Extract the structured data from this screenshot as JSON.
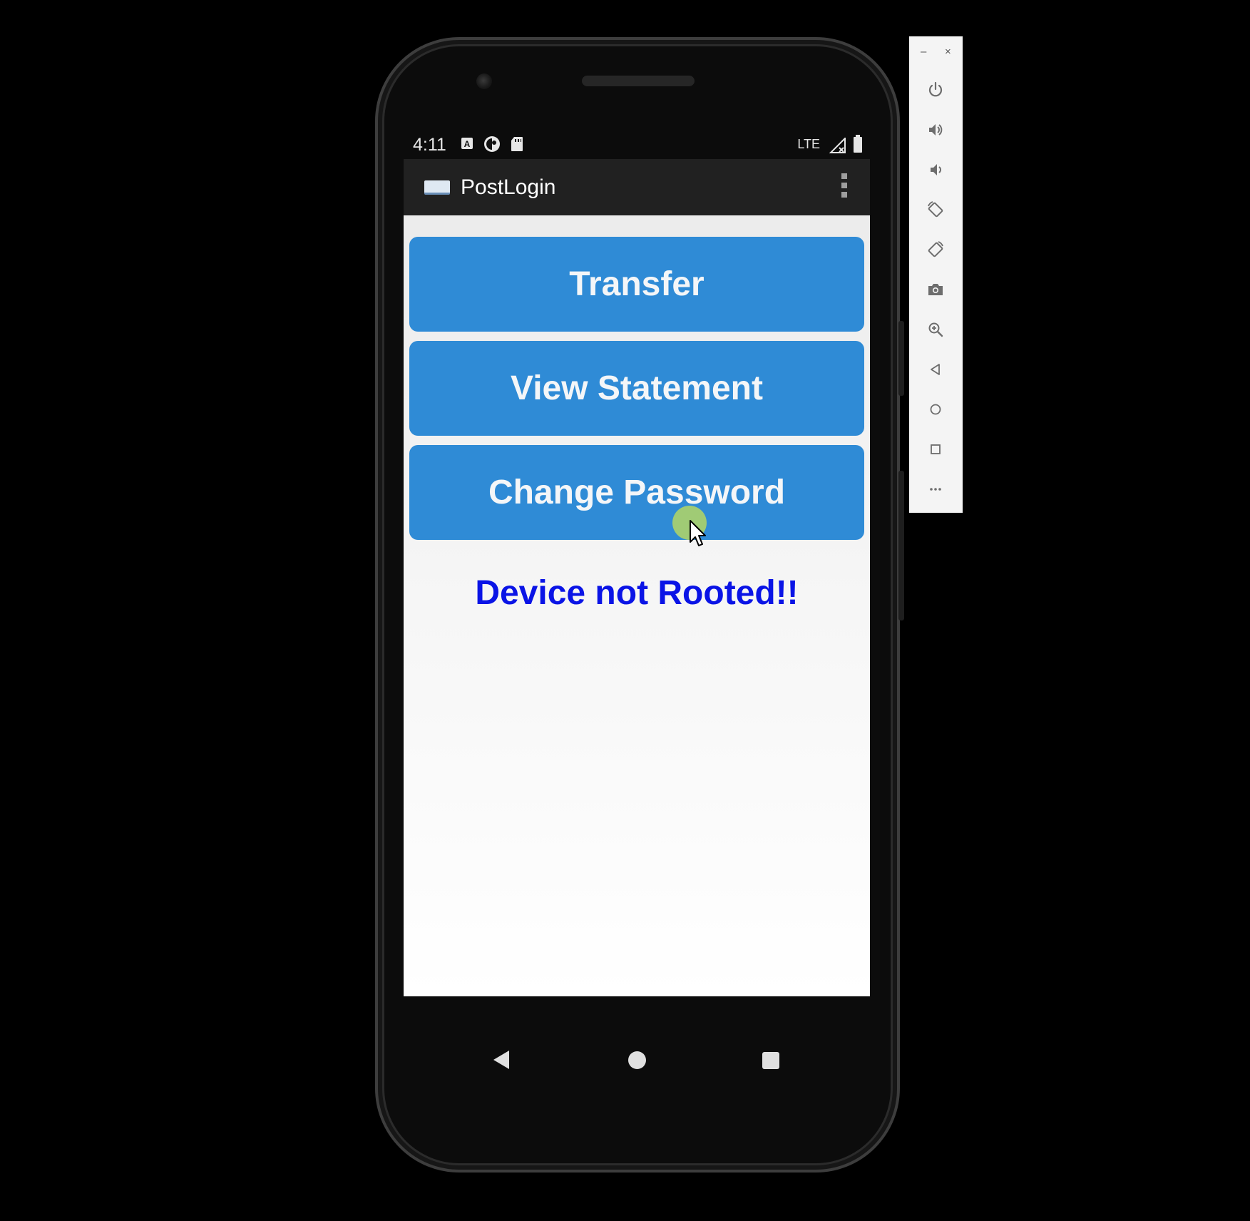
{
  "status_bar": {
    "time": "4:11",
    "network": "LTE",
    "icons": [
      "a-notification-icon",
      "circle-half-icon",
      "sd-card-icon",
      "signal-icon",
      "battery-icon"
    ]
  },
  "app_bar": {
    "title": "PostLogin",
    "logo_icon": "app-logo-icon",
    "menu_icon": "overflow-menu-icon"
  },
  "main": {
    "buttons": [
      {
        "label": "Transfer"
      },
      {
        "label": "View Statement"
      },
      {
        "label": "Change Password"
      }
    ],
    "status_message": "Device not Rooted!!"
  },
  "nav_bar": {
    "icons": [
      "back-icon",
      "home-icon",
      "recents-icon"
    ]
  },
  "emulator_toolbar": {
    "window_controls": [
      "minimize",
      "close"
    ],
    "buttons": [
      "power",
      "volume-up",
      "volume-down",
      "rotate-left",
      "rotate-right",
      "screenshot",
      "zoom",
      "back",
      "home",
      "overview",
      "more"
    ]
  },
  "colors": {
    "button_bg": "#2f8bd6",
    "status_message": "#0a14e6",
    "app_bar": "#212121",
    "touch_indicator": "#b4d664"
  }
}
